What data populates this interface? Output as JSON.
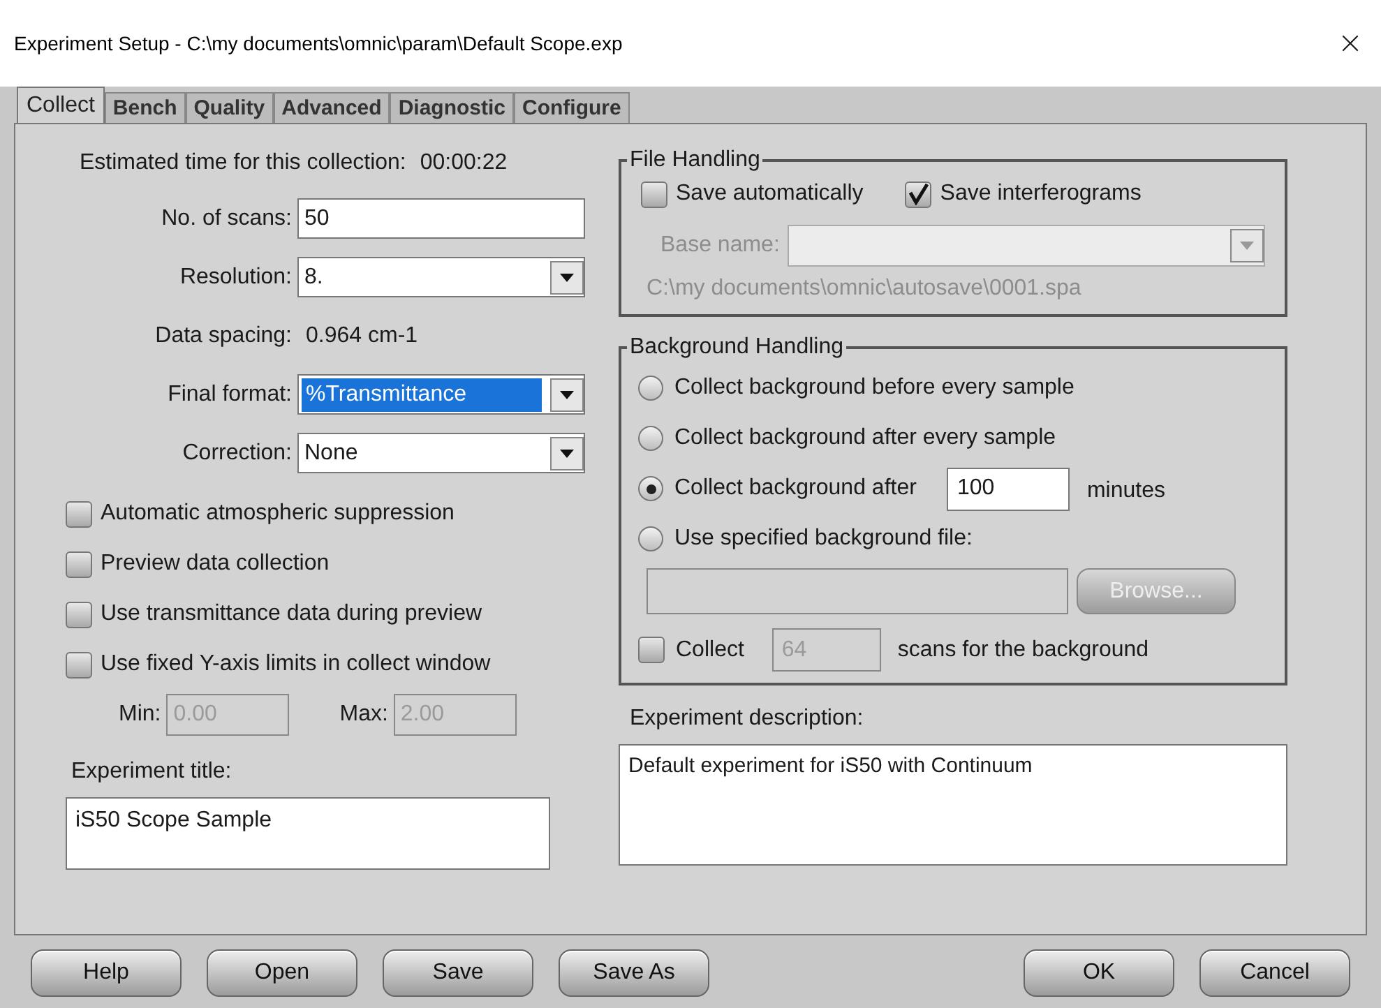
{
  "window": {
    "title": "Experiment Setup - C:\\my documents\\omnic\\param\\Default Scope.exp"
  },
  "tabs": [
    {
      "label": "Collect",
      "selected": true
    },
    {
      "label": "Bench",
      "selected": false
    },
    {
      "label": "Quality",
      "selected": false
    },
    {
      "label": "Advanced",
      "selected": false
    },
    {
      "label": "Diagnostic",
      "selected": false
    },
    {
      "label": "Configure",
      "selected": false
    }
  ],
  "collect": {
    "estimate": {
      "label": "Estimated time for this collection:",
      "value": "00:00:22"
    },
    "fields": [
      {
        "label": "No. of scans:",
        "kind": "input",
        "value": "50"
      },
      {
        "label": "Resolution:",
        "kind": "select",
        "value": "8.",
        "highlighted": false
      },
      {
        "label": "Data spacing:",
        "kind": "text",
        "value": "0.964 cm-1"
      },
      {
        "label": "Final format:",
        "kind": "select",
        "value": "%Transmittance",
        "highlighted": true
      },
      {
        "label": "Correction:",
        "kind": "select",
        "value": "None",
        "highlighted": false
      }
    ],
    "options": [
      {
        "label": "Automatic atmospheric suppression",
        "checked": false
      },
      {
        "label": "Preview data collection",
        "checked": false
      },
      {
        "label": "Use transmittance data during preview",
        "checked": false
      },
      {
        "label": "Use fixed Y-axis limits in collect window",
        "checked": false
      }
    ],
    "limits": [
      {
        "label": "Min:",
        "value": "0.00",
        "disabled": true
      },
      {
        "label": "Max:",
        "value": "2.00",
        "disabled": true
      }
    ],
    "title": {
      "label": "Experiment title:",
      "value": "iS50 Scope Sample"
    }
  },
  "file_handling": {
    "legend": "File Handling",
    "options": [
      {
        "label": "Save automatically",
        "checked": false
      },
      {
        "label": "Save interferograms",
        "checked": true
      }
    ],
    "base_name": {
      "label": "Base name:",
      "disabled": true
    },
    "path": "C:\\my documents\\omnic\\autosave\\0001.spa"
  },
  "background": {
    "legend": "Background Handling",
    "choices": [
      {
        "label": "Collect background before every sample",
        "selected": false,
        "kind": "plain"
      },
      {
        "label": "Collect background after every sample",
        "selected": false,
        "kind": "plain"
      },
      {
        "label": "Collect background after",
        "selected": true,
        "kind": "minutes"
      },
      {
        "label": "Use specified background file:",
        "selected": false,
        "kind": "plain"
      }
    ],
    "minutes": {
      "value": "100",
      "unit": "minutes"
    },
    "browse": {
      "label": "Browse...",
      "disabled": true
    },
    "scans": {
      "label": "Collect",
      "checked": false,
      "value": "64",
      "disabled": true,
      "suffix": "scans for the background"
    }
  },
  "description": {
    "label": "Experiment description:",
    "value": "Default experiment for iS50 with Continuum"
  },
  "left_buttons": [
    "Help",
    "Open",
    "Save",
    "Save As"
  ],
  "right_buttons": [
    "OK",
    "Cancel"
  ]
}
